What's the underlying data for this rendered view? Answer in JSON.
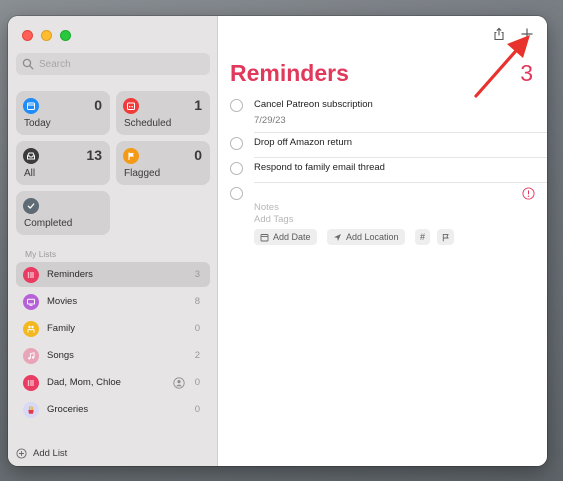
{
  "sidebar": {
    "search_placeholder": "Search",
    "smart_lists": [
      {
        "name": "today",
        "label": "Today",
        "count": "0",
        "color": "#1f8cf7",
        "icon": "calendar-icon"
      },
      {
        "name": "scheduled",
        "label": "Scheduled",
        "count": "1",
        "color": "#ef3c3a",
        "icon": "calendar-grid-icon"
      },
      {
        "name": "all",
        "label": "All",
        "count": "13",
        "color": "#3b3b3b",
        "icon": "tray-icon"
      },
      {
        "name": "flagged",
        "label": "Flagged",
        "count": "0",
        "color": "#f59a16",
        "icon": "flag-icon"
      },
      {
        "name": "completed",
        "label": "Completed",
        "count": "",
        "color": "#5e6a74",
        "icon": "checkmark-icon"
      }
    ],
    "my_lists_title": "My Lists",
    "lists": [
      {
        "label": "Reminders",
        "count": "3",
        "color": "#ea3b62",
        "icon": "list-bullet-icon"
      },
      {
        "label": "Movies",
        "count": "8",
        "color": "#b661d8",
        "icon": "tv-icon"
      },
      {
        "label": "Family",
        "count": "0",
        "color": "#f3b71f",
        "icon": "people-icon"
      },
      {
        "label": "Songs",
        "count": "2",
        "color": "#e9a4b8",
        "icon": "music-note-icon"
      },
      {
        "label": "Dad, Mom, Chloe",
        "count": "0",
        "color": "#ea3b62",
        "icon": "list-bullet-icon"
      },
      {
        "label": "Groceries",
        "count": "0",
        "color": "#d7d9f5",
        "icon": "fries-icon"
      }
    ],
    "add_list_label": "Add List"
  },
  "main": {
    "title": "Reminders",
    "count": "3",
    "accent_color": "#e0395b",
    "reminders": [
      {
        "text": "Cancel Patreon subscription",
        "date": "7/29/23"
      },
      {
        "text": "Drop off Amazon return",
        "date": ""
      },
      {
        "text": "Respond to family email thread",
        "date": ""
      }
    ],
    "new_reminder": {
      "notes_placeholder": "Notes",
      "tags_placeholder": "Add Tags",
      "add_date_label": "Add Date",
      "add_location_label": "Add Location",
      "tag_symbol": "#"
    }
  }
}
